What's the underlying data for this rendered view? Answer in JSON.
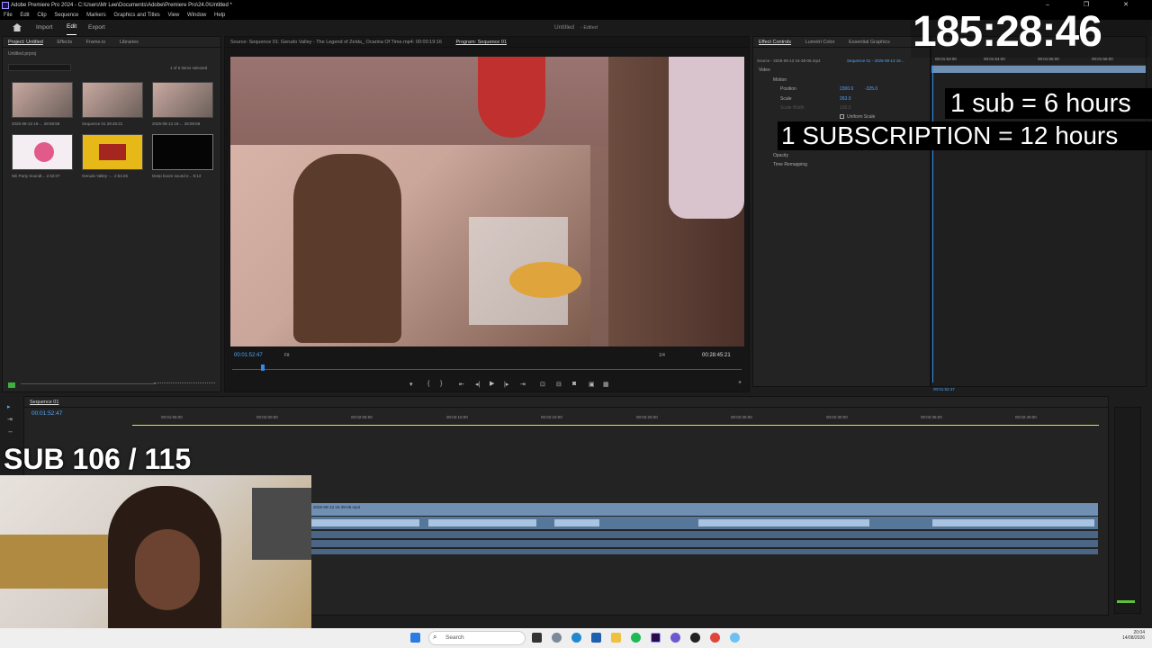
{
  "window": {
    "title": "Adobe Premiere Pro 2024 - C:\\Users\\Mr Lee\\Documents\\Adobe\\Premiere Pro\\24.0\\Untitled *",
    "controls": [
      "–",
      "❐",
      "✕"
    ]
  },
  "menu": [
    "File",
    "Edit",
    "Clip",
    "Sequence",
    "Markers",
    "Graphics and Titles",
    "View",
    "Window",
    "Help"
  ],
  "header": {
    "tabs": [
      "Import",
      "Edit",
      "Export"
    ],
    "active_tab": "Edit",
    "project_name": "Untitled",
    "status": "- Edited"
  },
  "project_panel": {
    "tabs": [
      "Project: Untitled",
      "Effects",
      "Frame.io",
      "Libraries"
    ],
    "file": "Untitled.prproj",
    "selection_info": "1 of 6 items selected",
    "items": [
      {
        "name": "2026-08-13 16-...",
        "duration": "28:59:58"
      },
      {
        "name": "Sequence 01",
        "duration": "28:45:21"
      },
      {
        "name": "2026-08-13 16-...",
        "duration": "28:59:58"
      },
      {
        "name": "Wii Party Soundt...",
        "duration": "2:32:07"
      },
      {
        "name": "Gerudo Valley -...",
        "duration": "2:54:25"
      },
      {
        "name": "Deep boom sound e...",
        "duration": "8:13"
      }
    ]
  },
  "source_monitor": {
    "title": "Source: Sequence 01: Gerudo Valley - The Legend of Zelda_ Ocarina Of Time.mp4: 00:00:19:16"
  },
  "program_monitor": {
    "title": "Program: Sequence 01",
    "timecode": "00:01:52:47",
    "fit": "Fit",
    "quality": "1/4",
    "duration": "00:28:45:21"
  },
  "effect_controls": {
    "tabs": [
      "Effect Controls",
      "Lumetri Color",
      "Essential Graphics"
    ],
    "source": "Source - 2026-08-13 16-39-06.mp4",
    "sequence": "Sequence 01 - 2026-08-13 16...",
    "section": "Video",
    "motion": "Motion",
    "position_label": "Position",
    "position_x": "2300.0",
    "position_y": "-325.0",
    "scale_label": "Scale",
    "scale_value": "263.0",
    "scale_width_label": "Scale Width",
    "scale_width_value": "100.0",
    "uniform_scale": "Uniform Scale",
    "opacity": "Opacity",
    "time_remapping": "Time Remapping",
    "ruler_ticks": [
      "00:01:53:00",
      "00:01:54:00",
      "00:01:55:00",
      "00:01:56:00"
    ],
    "current_time": "00:01:52:47"
  },
  "timeline": {
    "tab": "Sequence 01",
    "timecode": "00:01:52:47",
    "ruler_ticks": [
      "00:01:55:00",
      "00:02:00:00",
      "00:02:05:00",
      "00:02:10:00",
      "00:02:15:00",
      "00:02:20:00",
      "00:02:25:00",
      "00:02:30:00",
      "00:02:35:00",
      "00:02:40:00"
    ],
    "clip_label": "2026-08-13 16-39-06.mp4"
  },
  "overlays": {
    "timer": "185:28:46",
    "sub_rate": "1 sub = 6 hours",
    "subscription_rate": "1 SUBSCRIPTION = 12 hours",
    "sub_count": "SUB 106 / 115"
  },
  "taskbar": {
    "search_placeholder": "Search",
    "time": "20:04",
    "date": "14/08/2026"
  },
  "colors": {
    "accent": "#2d8ceb",
    "clip": "#6f8fb3",
    "timeline_work_area": "#e6e04a"
  }
}
